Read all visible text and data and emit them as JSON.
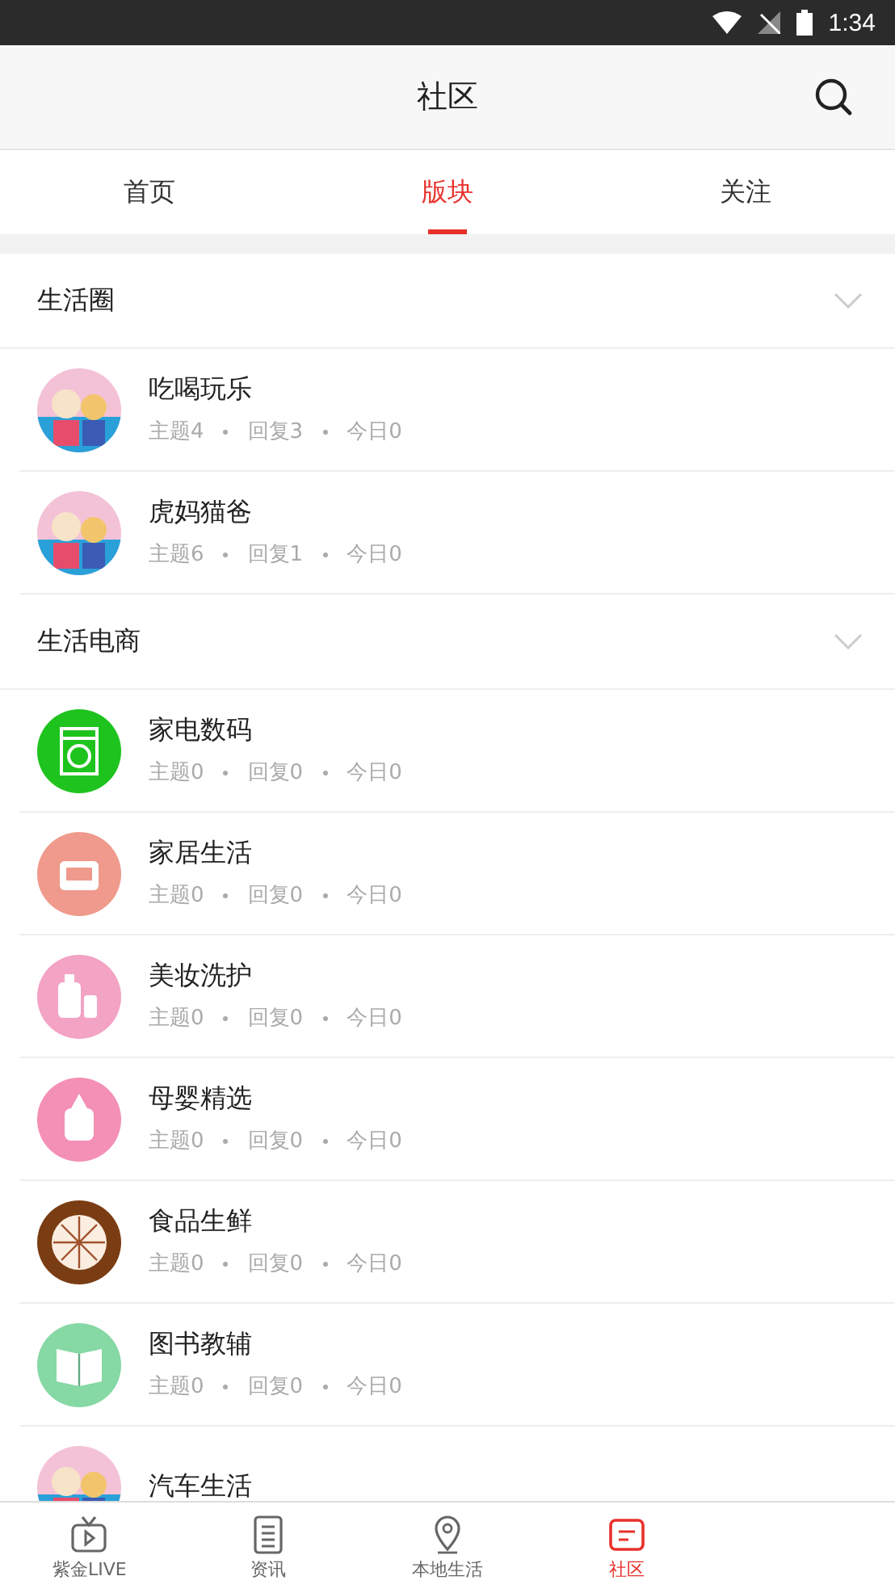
{
  "status_bar": {
    "time": "1:34"
  },
  "header": {
    "title": "社区"
  },
  "tabs": [
    {
      "label": "首页",
      "selected": false
    },
    {
      "label": "版块",
      "selected": true
    },
    {
      "label": "关注",
      "selected": false
    }
  ],
  "sections": [
    {
      "title": "生活圈",
      "items": [
        {
          "kind": "picture",
          "name": "吃喝玩乐",
          "stats": [
            "主题4",
            "回复3",
            "今日0"
          ]
        },
        {
          "kind": "picture",
          "name": "虎妈猫爸",
          "stats": [
            "主题6",
            "回复1",
            "今日0"
          ]
        }
      ]
    },
    {
      "title": "生活电商",
      "items": [
        {
          "kind": "washer",
          "name": "家电数码",
          "stats": [
            "主题0",
            "回复0",
            "今日0"
          ]
        },
        {
          "kind": "sofa",
          "name": "家居生活",
          "stats": [
            "主题0",
            "回复0",
            "今日0"
          ]
        },
        {
          "kind": "bottles",
          "name": "美妆洗护",
          "stats": [
            "主题0",
            "回复0",
            "今日0"
          ]
        },
        {
          "kind": "babybottle",
          "name": "母婴精选",
          "stats": [
            "主题0",
            "回复0",
            "今日0"
          ]
        },
        {
          "kind": "orange",
          "name": "食品生鲜",
          "stats": [
            "主题0",
            "回复0",
            "今日0"
          ]
        },
        {
          "kind": "book",
          "name": "图书教辅",
          "stats": [
            "主题0",
            "回复0",
            "今日0"
          ]
        },
        {
          "kind": "picture",
          "name": "汽车生活"
        }
      ]
    }
  ],
  "bottom_nav": [
    {
      "kind": "tv",
      "label": "紫金LIVE",
      "selected": false
    },
    {
      "kind": "news",
      "label": "资讯",
      "selected": false
    },
    {
      "kind": "pin",
      "label": "本地生活",
      "selected": false
    },
    {
      "kind": "community",
      "label": "社区",
      "selected": true
    }
  ]
}
